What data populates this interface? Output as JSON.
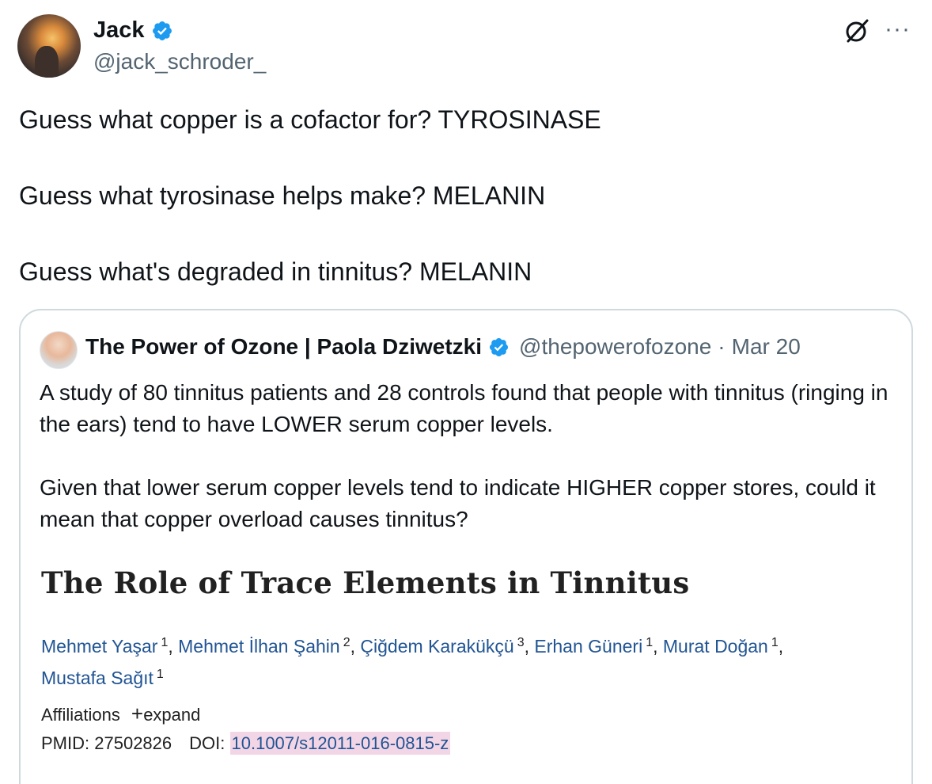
{
  "post": {
    "author": {
      "display_name": "Jack",
      "handle": "@jack_schroder_",
      "verified": true,
      "avatar_icon": "avatar-photo"
    },
    "actions": {
      "grok_icon": "grok-icon",
      "more_icon": "more-options-icon",
      "more_glyph": "···"
    },
    "text": [
      "Guess what copper is a cofactor for? TYROSINASE",
      "Guess what tyrosinase helps make? MELANIN",
      "Guess what's degraded in tinnitus? MELANIN"
    ]
  },
  "quote": {
    "author": {
      "display_name": "The Power of Ozone | Paola Dziwetzki",
      "handle": "@thepowerofozone",
      "date": "Mar 20",
      "separator": "·",
      "verified": true
    },
    "text": [
      "A study of 80 tinnitus patients and 28 controls found that people with tinnitus (ringing in the ears) tend to have LOWER serum copper levels.",
      "Given that lower serum copper levels tend to indicate HIGHER copper stores, could it mean that copper overload causes tinnitus?"
    ],
    "paper": {
      "title": "The Role of Trace Elements in Tinnitus",
      "authors": [
        {
          "name": "Mehmet Yaşar",
          "aff": "1"
        },
        {
          "name": "Mehmet İlhan Şahin",
          "aff": "2"
        },
        {
          "name": "Çiğdem Karakükçü",
          "aff": "3"
        },
        {
          "name": "Erhan Güneri",
          "aff": "1"
        },
        {
          "name": "Murat Doğan",
          "aff": "1"
        },
        {
          "name": "Mustafa Sağıt",
          "aff": "1"
        }
      ],
      "affiliations_label": "Affiliations",
      "expand_plus": "+",
      "expand_label": "expand",
      "pmid_label": "PMID:",
      "pmid": "27502826",
      "doi_label": "DOI:",
      "doi": "10.1007/s12011-016-0815-z"
    }
  },
  "colors": {
    "verified_blue": "#1d9bf0",
    "link_blue": "#205493",
    "doi_highlight": "#f3d6e6",
    "secondary_text": "#536471",
    "card_border": "#cfd9de"
  }
}
